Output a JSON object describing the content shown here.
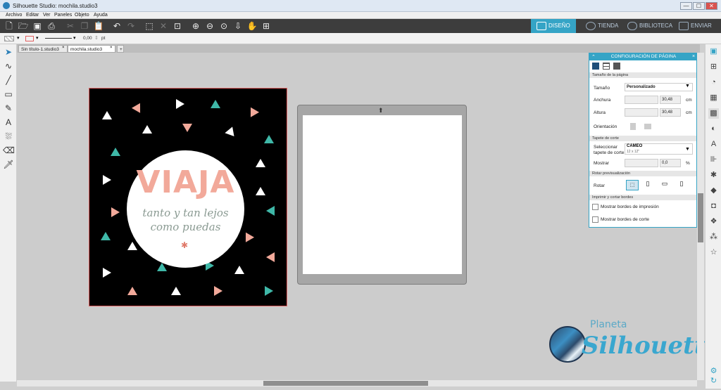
{
  "window": {
    "title": "Silhouette Studio: mochila.studio3",
    "controls": [
      "—",
      "☐",
      "✕"
    ]
  },
  "menu": [
    "Archivo",
    "Editar",
    "Ver",
    "Paneles",
    "Objeto",
    "Ayuda"
  ],
  "modes": {
    "diseno": "DISEÑO",
    "tienda": "TIENDA",
    "biblioteca": "BIBLIOTECA",
    "enviar": "ENVIAR"
  },
  "propbar": {
    "line_width": "0,00",
    "unit": "pt"
  },
  "doc_tabs": [
    "Sin título-1.studio3",
    "mochila.studio3"
  ],
  "design": {
    "title": "VIAJA",
    "line1": "tanto y tan lejos",
    "line2": "como puedas",
    "star": "✱"
  },
  "panel": {
    "title": "CONFIGURACIÓN DE PÁGINA",
    "sec_size": "Tamaño de la página",
    "size_label": "Tamaño",
    "size_value": "Personalizado",
    "width_label": "Anchura",
    "width_value": "30,48",
    "width_unit": "cm",
    "height_label": "Altura",
    "height_value": "30,48",
    "height_unit": "cm",
    "orient_label": "Orientación",
    "sec_mat": "Tapete de corte",
    "mat_label1": "Seleccionar",
    "mat_label2": "tapete de corte",
    "mat_value": "CAMEO",
    "mat_sub": "12 x 12\"",
    "show_label": "Mostrar",
    "show_value": "0,0",
    "show_unit": "%",
    "sec_rotate": "Rotar previsualización",
    "rotate_label": "Rotar",
    "sec_print": "Imprimir y cortar bordes",
    "print_borders": "Mostrar bordes de impresión",
    "cut_borders": "Mostrar bordes de corte"
  },
  "logo": {
    "line1": "Planeta",
    "line2": "Silhouette"
  },
  "colors": {
    "accent": "#35a4c6",
    "coral": "#f2a99a",
    "teal": "#3fb8a8"
  }
}
